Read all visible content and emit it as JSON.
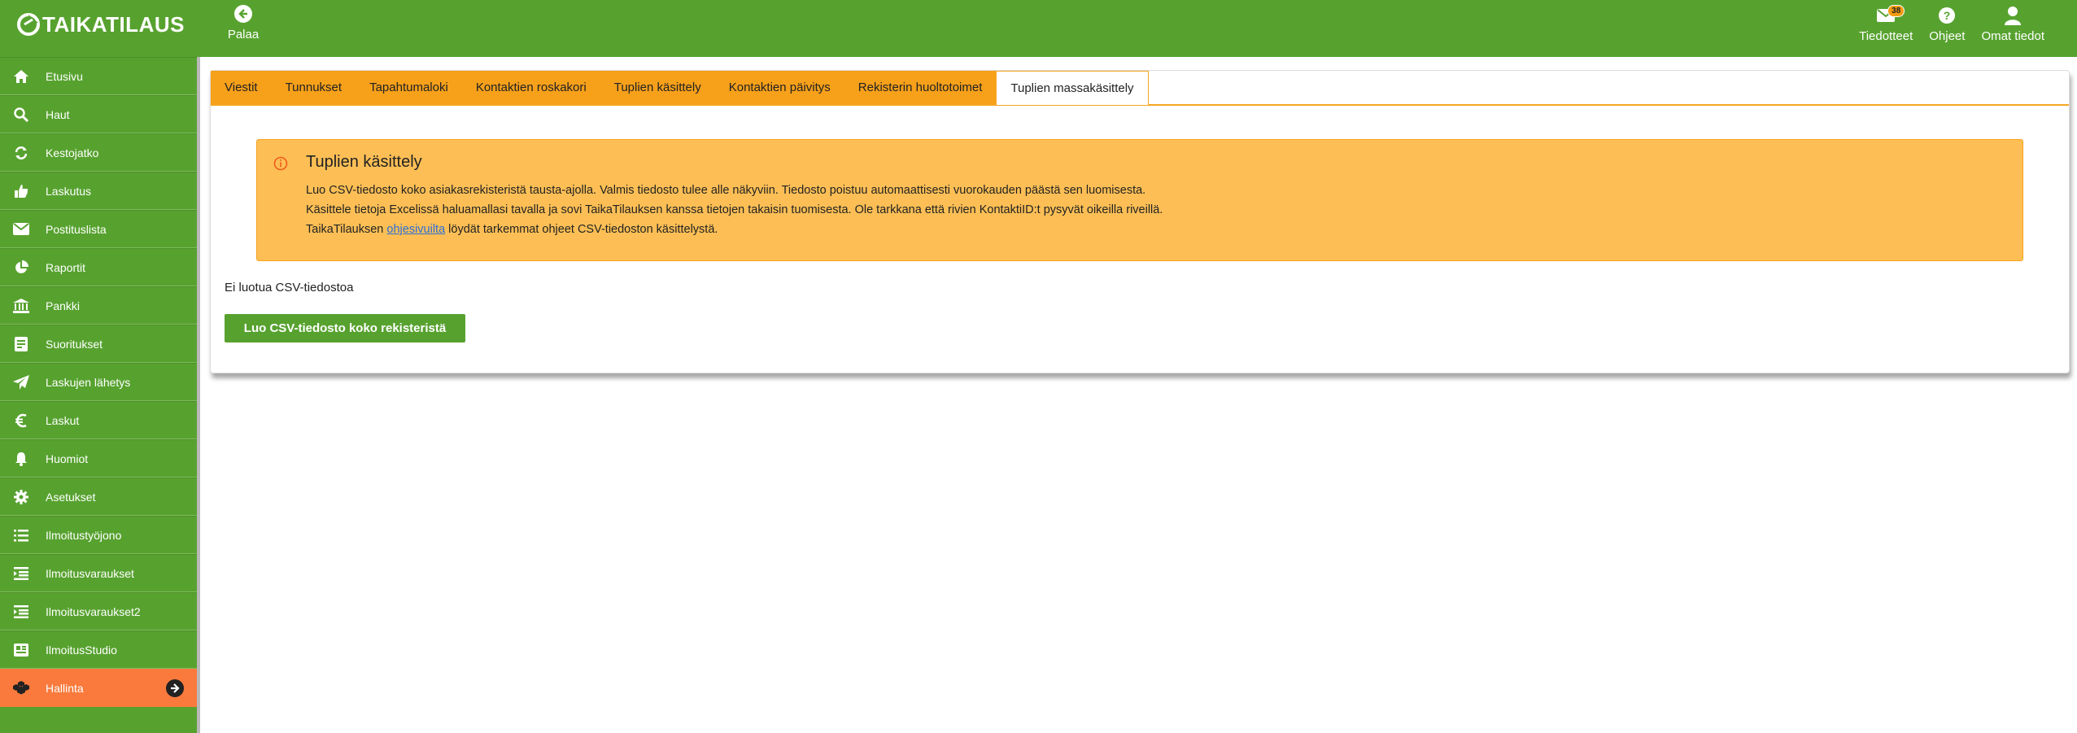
{
  "app": {
    "logo_text": "TAIKATILAUS",
    "brand_green": "#57a22f",
    "accent_orange": "#f97a3c"
  },
  "header": {
    "back_label": "Palaa",
    "notifications": {
      "label": "Tiedotteet",
      "count": "38"
    },
    "help_label": "Ohjeet",
    "profile_label": "Omat tiedot"
  },
  "sidebar": {
    "items": [
      {
        "label": "Etusivu",
        "icon": "home-icon"
      },
      {
        "label": "Haut",
        "icon": "search-icon"
      },
      {
        "label": "Kestojatko",
        "icon": "refresh-icon"
      },
      {
        "label": "Laskutus",
        "icon": "thumbs-up-icon"
      },
      {
        "label": "Postituslista",
        "icon": "envelope-icon"
      },
      {
        "label": "Raportit",
        "icon": "pie-chart-icon"
      },
      {
        "label": "Pankki",
        "icon": "bank-icon"
      },
      {
        "label": "Suoritukset",
        "icon": "receipt-icon"
      },
      {
        "label": "Laskujen lähetys",
        "icon": "paper-plane-icon"
      },
      {
        "label": "Laskut",
        "icon": "euro-icon"
      },
      {
        "label": "Huomiot",
        "icon": "bell-icon"
      },
      {
        "label": "Asetukset",
        "icon": "gear-icon"
      },
      {
        "label": "Ilmoitustyöjono",
        "icon": "list-icon"
      },
      {
        "label": "Ilmoitusvaraukset",
        "icon": "indent-list-icon"
      },
      {
        "label": "Ilmoitusvaraukset2",
        "icon": "indent-list-icon"
      },
      {
        "label": "IlmoitusStudio",
        "icon": "newspaper-icon"
      },
      {
        "label": "Hallinta",
        "icon": "cubes-icon"
      }
    ]
  },
  "tabs": [
    {
      "label": "Viestit"
    },
    {
      "label": "Tunnukset"
    },
    {
      "label": "Tapahtumaloki"
    },
    {
      "label": "Kontaktien roskakori"
    },
    {
      "label": "Tuplien käsittely"
    },
    {
      "label": "Kontaktien päivitys"
    },
    {
      "label": "Rekisterin huoltotoimet"
    },
    {
      "label": "Tuplien massakäsittely"
    }
  ],
  "alert": {
    "title": "Tuplien käsittely",
    "line1": "Luo CSV-tiedosto koko asiakasrekisteristä tausta-ajolla. Valmis tiedosto tulee alle näkyviin. Tiedosto poistuu automaattisesti vuorokauden päästä sen luomisesta.",
    "line2": "Käsittele tietoja Excelissä haluamallasi tavalla ja sovi TaikaTilauksen kanssa tietojen takaisin tuomisesta. Ole tarkkana että rivien KontaktiID:t pysyvät oikeilla riveillä.",
    "line3_pre": "TaikaTilauksen ",
    "line3_link": "ohjesivuilta",
    "line3_post": " löydät tarkemmat ohjeet CSV-tiedoston käsittelystä."
  },
  "main": {
    "no_files_text": "Ei luotua CSV-tiedostoa",
    "create_button": "Luo CSV-tiedosto koko rekisteristä"
  }
}
